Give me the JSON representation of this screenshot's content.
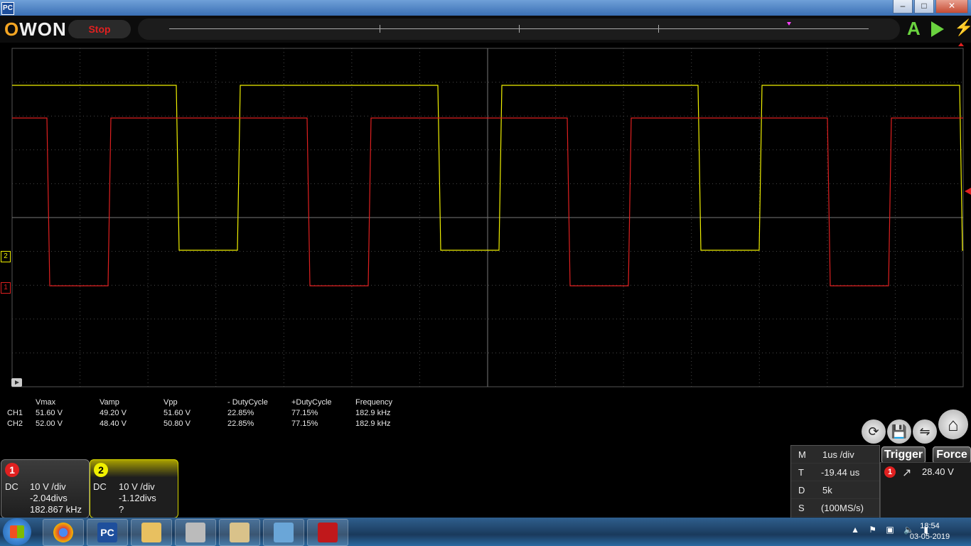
{
  "window": {
    "app_icon": "PC",
    "title": ""
  },
  "toolbar": {
    "logo_o": "O",
    "logo_rest": "WON",
    "stop_label": "Stop",
    "auto_label": "A",
    "run_icon": "play-icon",
    "bolt_icon": "lightning-icon"
  },
  "colors": {
    "ch1": "#e02020",
    "ch2": "#f0f000",
    "grid": "#4a4a4a",
    "accent": "#6ad23f"
  },
  "screen_markers": {
    "ch2_marker": "2",
    "ch1_marker": "1"
  },
  "measurements": {
    "headers": [
      "Vmax",
      "Vamp",
      "Vpp",
      "- DutyCycle",
      "+DutyCycle",
      "Frequency"
    ],
    "rows": [
      {
        "channel": "CH1",
        "values": [
          "51.60 V",
          "49.20 V",
          "51.60 V",
          "22.85%",
          "77.15%",
          "182.9 kHz"
        ]
      },
      {
        "channel": "CH2",
        "values": [
          "52.00 V",
          "48.40 V",
          "50.80 V",
          "22.85%",
          "77.15%",
          "182.9 kHz"
        ]
      }
    ]
  },
  "ch1_panel": {
    "num": "1",
    "coupling": "DC",
    "scale": "10 V /div",
    "offset": "-2.04divs",
    "freq": "182.867 kHz"
  },
  "ch2_panel": {
    "num": "2",
    "coupling": "DC",
    "scale": "10 V /div",
    "offset": "-1.12divs",
    "freq": "?"
  },
  "horizontal": {
    "m_label": "M",
    "m_value": "1us /div",
    "t_label": "T",
    "t_value": "-19.44 us",
    "d_label": "D",
    "d_value": "5k",
    "s_label": "S",
    "s_value": "(100MS/s)"
  },
  "trigger": {
    "trigger_label": "Trigger",
    "force_label": "Force",
    "source": "1",
    "level": "28.40 V"
  },
  "taskbar": {
    "pc_label": "PC",
    "time": "18:54",
    "date": "03-05-2019"
  }
}
